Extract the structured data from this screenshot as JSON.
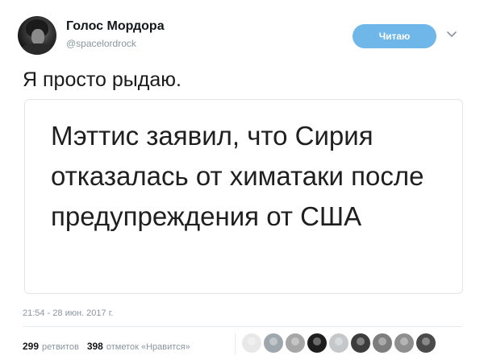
{
  "tweet": {
    "author_name": "Голос Мордора",
    "author_handle": "@spacelordrock",
    "follow_label": "Читаю",
    "text": "Я просто рыдаю.",
    "card_text": "Мэттис заявил, что Сирия отказалась от химатаки после предупреждения от США",
    "timestamp": "21:54 - 28 июн. 2017 г."
  },
  "stats": {
    "retweets_count": "299",
    "retweets_label": "ретвитов",
    "likes_count": "398",
    "likes_label": "отметок «Нравится»"
  },
  "likers": [
    {
      "name": "liker-avatar-1",
      "color": "#e8e8e8"
    },
    {
      "name": "liker-avatar-2",
      "color": "#9ea7ad"
    },
    {
      "name": "liker-avatar-3",
      "color": "#a6a6a6"
    },
    {
      "name": "liker-avatar-4",
      "color": "#1e1e1e"
    },
    {
      "name": "liker-avatar-5",
      "color": "#c4c8cb"
    },
    {
      "name": "liker-avatar-6",
      "color": "#3d3d3d"
    },
    {
      "name": "liker-avatar-7",
      "color": "#7d7d7d"
    },
    {
      "name": "liker-avatar-8",
      "color": "#8e8e8e"
    },
    {
      "name": "liker-avatar-9",
      "color": "#4a4a4a"
    }
  ],
  "colors": {
    "accent": "#6fb6e9",
    "muted_text": "#8a959e"
  },
  "icons": {
    "chevron": "chevron-down-icon"
  }
}
